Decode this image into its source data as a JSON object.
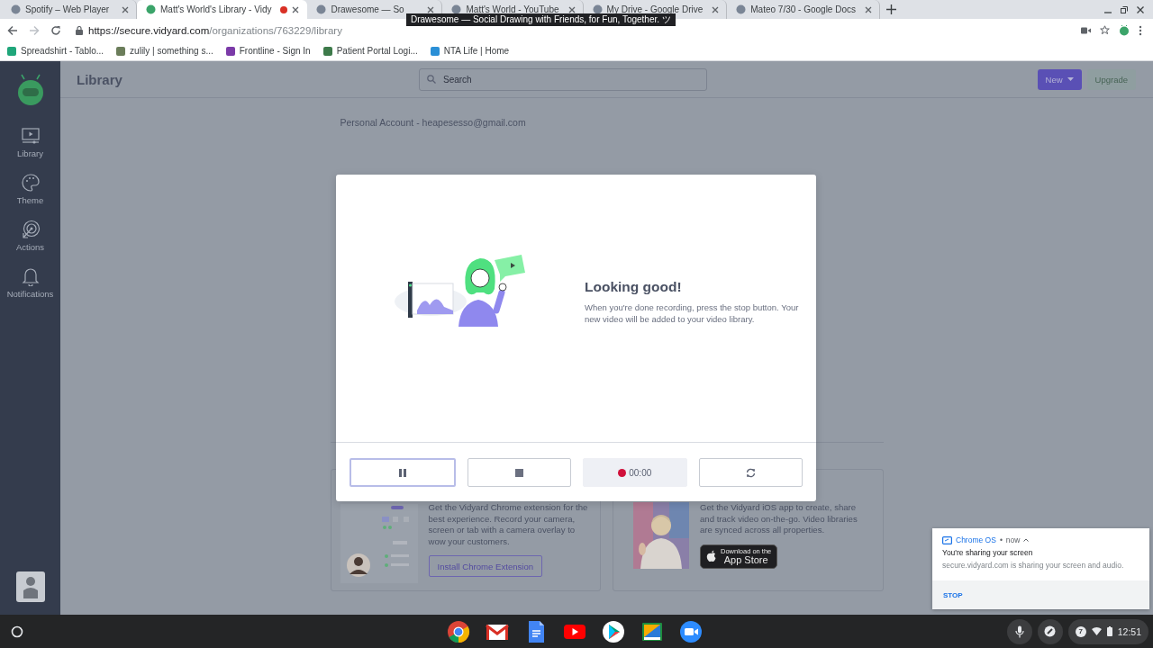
{
  "browser": {
    "tabs": [
      {
        "title": "Spotify – Web Player",
        "selected": false,
        "recording": false
      },
      {
        "title": "Matt's World's Library - Vidy",
        "selected": true,
        "recording": true
      },
      {
        "title": "Drawesome — So",
        "selected": false,
        "recording": false
      },
      {
        "title": "Matt's World - YouTube",
        "selected": false,
        "recording": false
      },
      {
        "title": "My Drive - Google Drive",
        "selected": false,
        "recording": false
      },
      {
        "title": "Mateo 7/30 - Google Docs",
        "selected": false,
        "recording": false
      }
    ],
    "tooltip": "Drawesome — Social Drawing with Friends, for Fun, Together. ツ",
    "address": {
      "origin": "https://secure.vidyard.com",
      "path": "/organizations/763229/library"
    },
    "bookmarks": [
      "Spreadshirt - Tablo...",
      "zulily | something s...",
      "Frontline - Sign In",
      "Patient Portal Logi...",
      "NTA Life | Home"
    ]
  },
  "sidebar": {
    "items": [
      {
        "kind": "library",
        "label": "Library"
      },
      {
        "kind": "theme",
        "label": "Theme"
      },
      {
        "kind": "actions",
        "label": "Actions"
      },
      {
        "kind": "notifications",
        "label": "Notifications"
      }
    ]
  },
  "header": {
    "title": "Library",
    "search": {
      "placeholder": "Search"
    },
    "buttons": [
      {
        "kind": "primary",
        "label": "New"
      },
      {
        "kind": "secondary",
        "label": "Upgrade"
      }
    ]
  },
  "account": "Personal Account - heapesesso@gmail.com",
  "cards": [
    {
      "kind": "extension",
      "text": "Get the Vidyard Chrome extension for the best experience. Record your camera, screen or tab with a camera overlay to wow your customers.",
      "button": "Install Chrome Extension"
    },
    {
      "kind": "ios",
      "text": "Get the Vidyard iOS app to create, share and track video on-the-go. Video libraries are synced across all properties.",
      "badge": {
        "small": "Download on the",
        "large": "App Store"
      }
    }
  ],
  "modal": {
    "title": "Looking good!",
    "message": "When you're done recording, press the stop button. Your new video will be added to your video library.",
    "controls": [
      {
        "kind": "pause",
        "focused": true
      },
      {
        "kind": "stop",
        "focused": false
      },
      {
        "kind": "timer",
        "text": "00:00",
        "recording": true,
        "focused": false
      },
      {
        "kind": "restart",
        "focused": false
      }
    ]
  },
  "notification": {
    "source": "Chrome OS",
    "separator": "•",
    "time": "now",
    "title": "You're sharing your screen",
    "body": "secure.vidyard.com is sharing your screen and audio.",
    "action": "STOP"
  },
  "shelf": {
    "apps": [
      {
        "kind": "chrome"
      },
      {
        "kind": "gmail"
      },
      {
        "kind": "docs"
      },
      {
        "kind": "youtube"
      },
      {
        "kind": "play"
      },
      {
        "kind": "classroom"
      },
      {
        "kind": "zoom"
      }
    ],
    "tray": {
      "badge": "7",
      "time": "12:51"
    }
  }
}
